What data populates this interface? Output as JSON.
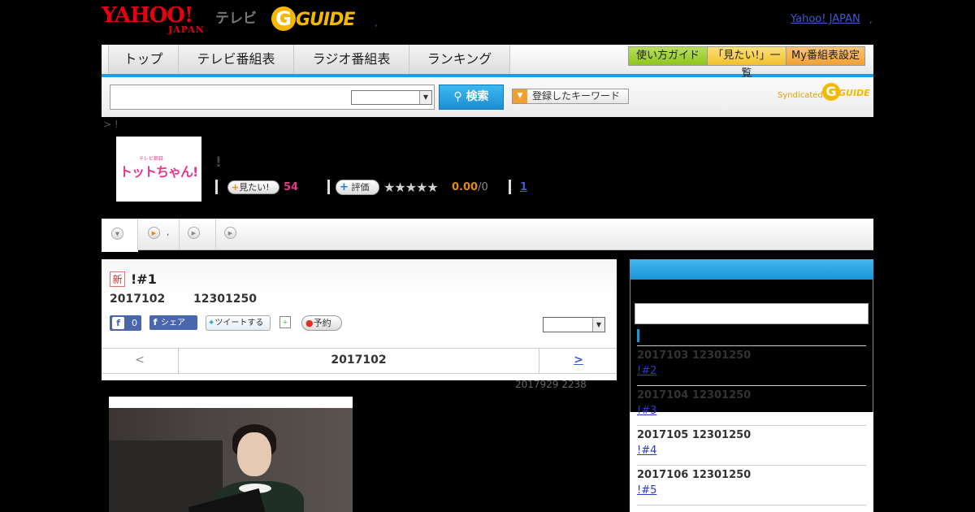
{
  "header": {
    "yahoo_logo": "YAHOO!",
    "yahoo_sub": "JAPAN",
    "tv_label": "テレビ",
    "gguide_logo": "GUIDE",
    "dot": ",",
    "yahoo_japan_link": "Yahoo! JAPAN",
    "yahoo_japan_dot": ","
  },
  "nav": {
    "tabs": [
      "トップ",
      "テレビ番組表",
      "ラジオ番組表",
      "ランキング"
    ],
    "buttons": [
      "使い方ガイド",
      "「見たい!」一覧",
      "My番組表設定"
    ],
    "button_colors": [
      "#8fc41f",
      "#f1c12a",
      "#f0a030"
    ]
  },
  "search": {
    "input_value": "",
    "select_value": "",
    "button_label": "検索",
    "keyword_button": "登録したキーワード",
    "syndicated_label": "Syndicated",
    "syndicated_logo": "GUIDE"
  },
  "breadcrumb": "> !",
  "program": {
    "thumbnail_text": "トットちゃん!",
    "title": "!",
    "mitai_label": "見たい!",
    "mitai_count": "54",
    "hyoka_label": "評価",
    "stars": "★★★★★",
    "score": "0.00",
    "score_total": "/0",
    "review_link": "1"
  },
  "subtabs": {
    "tab2_text": ","
  },
  "episode": {
    "new_badge": "新",
    "title": "!#1",
    "date": "2017102",
    "time": "12301250",
    "fb_like_count": "0",
    "fb_share_label": "シェア",
    "tweet_label": "ツイートする",
    "reserve_label": "予約",
    "nav_prev": "<",
    "nav_current": "2017102",
    "nav_next": ">",
    "updated": "2017929  2238"
  },
  "sidebar": {
    "items": [
      {
        "date": "2017103  12301250",
        "link": "!#2 "
      },
      {
        "date": "2017104  12301250",
        "link": "!#3 "
      },
      {
        "date": "2017105  12301250",
        "link": "!#4 "
      },
      {
        "date": "2017106  12301250",
        "link": "!#5 "
      }
    ]
  }
}
